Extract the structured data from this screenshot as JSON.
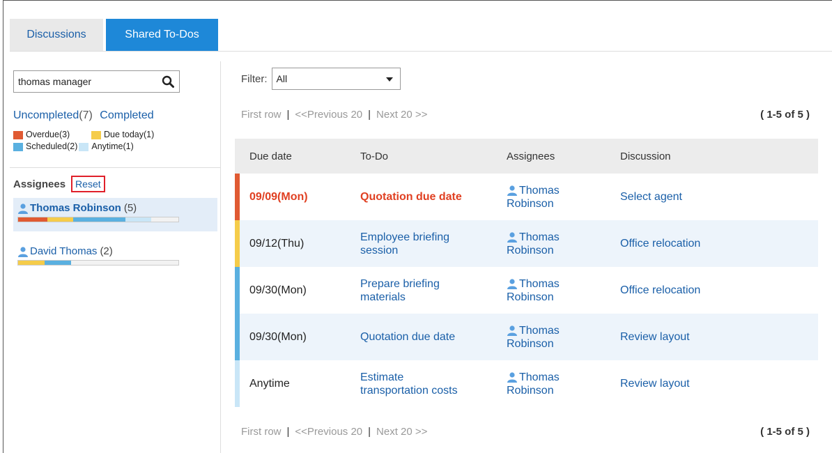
{
  "tabs": [
    {
      "label": "Discussions",
      "active": false
    },
    {
      "label": "Shared To-Dos",
      "active": true
    }
  ],
  "sidebar": {
    "search_value": "thomas manager",
    "uncompleted_label": "Uncompleted",
    "uncompleted_count": "(7)",
    "completed_label": "Completed",
    "legend": [
      {
        "label": "Overdue(3)",
        "color": "#e05a33"
      },
      {
        "label": "Due today(1)",
        "color": "#f5cc4a"
      },
      {
        "label": "Scheduled(2)",
        "color": "#5ab0e0"
      },
      {
        "label": "Anytime(1)",
        "color": "#c9e6f7"
      }
    ],
    "assignees_heading": "Assignees",
    "reset_label": "Reset",
    "assignees": [
      {
        "name": "Thomas Robinson",
        "count": "(5)",
        "selected": true
      },
      {
        "name": "David Thomas",
        "count": "(2)",
        "selected": false
      }
    ]
  },
  "main": {
    "filter_label": "Filter:",
    "filter_value": "All",
    "pager": {
      "first": "First row",
      "prev": "<<Previous 20",
      "next": "Next 20 >>",
      "count": "( 1-5 of 5 )"
    },
    "columns": [
      "Due date",
      "To-Do",
      "Assignees",
      "Discussion"
    ],
    "rows": [
      {
        "due": "09/09(Mon)",
        "todo_l1": "Quotation due date",
        "todo_l2": "",
        "assignee_l1": "Thomas",
        "assignee_l2": "Robinson",
        "discussion": "Select agent",
        "status": "overdue",
        "color": "#e05a33"
      },
      {
        "due": "09/12(Thu)",
        "todo_l1": "Employee briefing",
        "todo_l2": "session",
        "assignee_l1": "Thomas",
        "assignee_l2": "Robinson",
        "discussion": "Office relocation",
        "status": "today",
        "color": "#f5cc4a"
      },
      {
        "due": "09/30(Mon)",
        "todo_l1": "Prepare briefing",
        "todo_l2": "materials",
        "assignee_l1": "Thomas",
        "assignee_l2": "Robinson",
        "discussion": "Office relocation",
        "status": "scheduled",
        "color": "#5ab0e0"
      },
      {
        "due": "09/30(Mon)",
        "todo_l1": "Quotation due date",
        "todo_l2": "",
        "assignee_l1": "Thomas",
        "assignee_l2": "Robinson",
        "discussion": "Review layout",
        "status": "scheduled",
        "color": "#5ab0e0"
      },
      {
        "due": "Anytime",
        "todo_l1": "Estimate",
        "todo_l2": "transportation costs",
        "assignee_l1": "Thomas",
        "assignee_l2": "Robinson",
        "discussion": "Review layout",
        "status": "anytime",
        "color": "#c9e6f7"
      }
    ]
  }
}
